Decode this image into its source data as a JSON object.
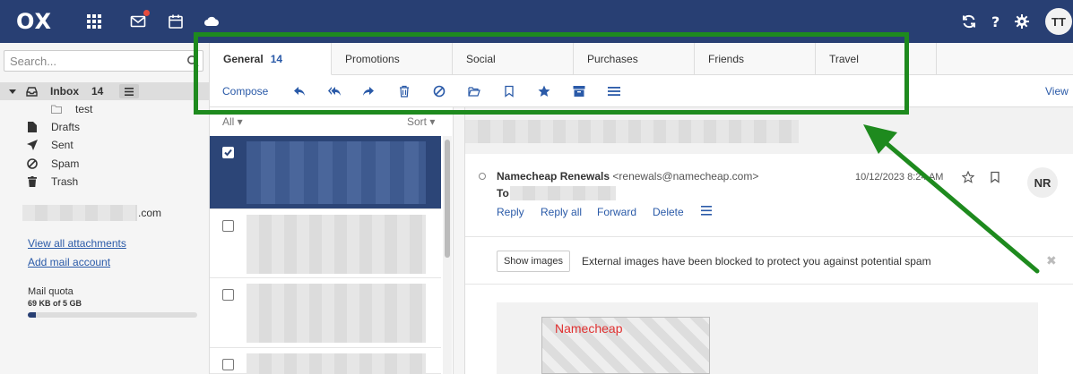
{
  "header": {
    "logo": "OX",
    "avatar_initials": "TT",
    "icons": [
      "apps-grid-icon",
      "mail-icon",
      "calendar-icon",
      "cloud-icon",
      "refresh-icon",
      "help-icon",
      "gear-icon"
    ]
  },
  "sidebar": {
    "search_placeholder": "Search...",
    "folders": [
      {
        "label": "Inbox",
        "count": "14",
        "icon": "inbox-icon"
      },
      {
        "label": "test",
        "icon": "folder-icon"
      },
      {
        "label": "Drafts",
        "icon": "file-icon"
      },
      {
        "label": "Sent",
        "icon": "send-icon"
      },
      {
        "label": "Spam",
        "icon": "ban-icon"
      },
      {
        "label": "Trash",
        "icon": "trash-icon"
      }
    ],
    "account_suffix": ".com",
    "view_attachments": "View all attachments",
    "add_account": "Add mail account",
    "quota_label": "Mail quota",
    "quota_value": "69 KB of 5 GB",
    "quota_fraction": 0.05
  },
  "tabs": [
    {
      "label": "General",
      "count": "14"
    },
    {
      "label": "Promotions"
    },
    {
      "label": "Social"
    },
    {
      "label": "Purchases"
    },
    {
      "label": "Friends"
    },
    {
      "label": "Travel"
    }
  ],
  "toolbar": {
    "compose": "Compose",
    "view": "View",
    "icons": [
      "reply-icon",
      "reply-all-icon",
      "forward-icon",
      "delete-icon",
      "spam-icon",
      "move-folder-icon",
      "flag-icon",
      "star-icon",
      "archive-icon",
      "more-icon"
    ]
  },
  "list": {
    "all_label": "All ▾",
    "sort_label": "Sort ▾"
  },
  "message": {
    "sender_name": "Namecheap Renewals",
    "sender_email": "<renewals@namecheap.com>",
    "to_label": "To",
    "date": "10/12/2023 8:24 AM",
    "sender_initials": "NR",
    "actions": [
      "Reply",
      "Reply all",
      "Forward",
      "Delete"
    ],
    "show_images": "Show images",
    "blocked_text": "External images have been blocked to protect you against potential spam",
    "image_alt": "Namecheap"
  },
  "colors": {
    "topbar": "#283f73",
    "link": "#2a5aa8",
    "annotation": "#1e8a1e"
  }
}
